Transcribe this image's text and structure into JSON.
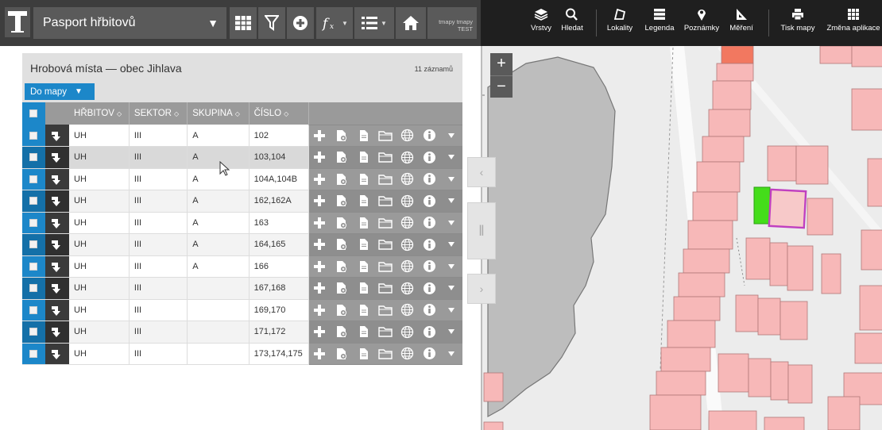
{
  "header": {
    "project_title": "Pasport hřbitovů",
    "user_name": "tmapy tmapy",
    "user_role": "TEST"
  },
  "map_menu": [
    {
      "label": "Vrstvy",
      "icon": "layers-icon"
    },
    {
      "label": "Hledat",
      "icon": "search-icon"
    },
    {
      "label": "Lokality",
      "icon": "locality-icon"
    },
    {
      "label": "Legenda",
      "icon": "legend-icon"
    },
    {
      "label": "Poznámky",
      "icon": "marker-icon"
    },
    {
      "label": "Měření",
      "icon": "measure-icon"
    },
    {
      "label": "Tisk mapy",
      "icon": "print-icon"
    },
    {
      "label": "Změna aplikace",
      "icon": "grid-icon"
    }
  ],
  "panel": {
    "title": "Hrobová místa — obec Jihlava",
    "records": "11 záznamů",
    "to_map_label": "Do mapy"
  },
  "table": {
    "columns": [
      "HŘBITOV",
      "SEKTOR",
      "SKUPINA",
      "ČÍSLO"
    ],
    "rows": [
      {
        "hrbitov": "UH",
        "sektor": "III",
        "skupina": "A",
        "cislo": "102"
      },
      {
        "hrbitov": "UH",
        "sektor": "III",
        "skupina": "A",
        "cislo": "103,104"
      },
      {
        "hrbitov": "UH",
        "sektor": "III",
        "skupina": "A",
        "cislo": "104A,104B"
      },
      {
        "hrbitov": "UH",
        "sektor": "III",
        "skupina": "A",
        "cislo": "162,162A"
      },
      {
        "hrbitov": "UH",
        "sektor": "III",
        "skupina": "A",
        "cislo": "163"
      },
      {
        "hrbitov": "UH",
        "sektor": "III",
        "skupina": "A",
        "cislo": "164,165"
      },
      {
        "hrbitov": "UH",
        "sektor": "III",
        "skupina": "A",
        "cislo": "166"
      },
      {
        "hrbitov": "UH",
        "sektor": "III",
        "skupina": "",
        "cislo": "167,168"
      },
      {
        "hrbitov": "UH",
        "sektor": "III",
        "skupina": "",
        "cislo": "169,170"
      },
      {
        "hrbitov": "UH",
        "sektor": "III",
        "skupina": "",
        "cislo": "171,172"
      },
      {
        "hrbitov": "UH",
        "sektor": "III",
        "skupina": "",
        "cislo": "173,174,175"
      }
    ]
  },
  "colors": {
    "accent_blue": "#1c87c9",
    "toolbar_dark": "#3d3d3d",
    "map_parcel": "#f7b8b8",
    "map_parcel_highlight": "#f27860",
    "map_selected_outline": "#c040c0",
    "map_selected_green": "#44dd1a"
  }
}
